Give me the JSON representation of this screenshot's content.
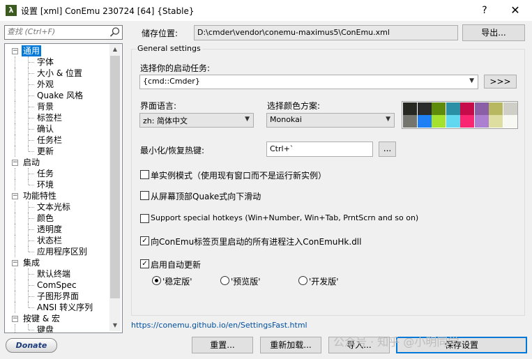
{
  "window": {
    "title": "设置 [xml] ConEmu 230724 [64] {Stable}",
    "app_icon_glyph": "λ",
    "help_glyph": "?",
    "close_glyph": "✕"
  },
  "search": {
    "placeholder": "查找 (Ctrl+F)",
    "value": ""
  },
  "tree": {
    "items": [
      {
        "label": "通用",
        "level": 0,
        "toggle": "−",
        "selected": true
      },
      {
        "label": "字体",
        "level": 1
      },
      {
        "label": "大小 & 位置",
        "level": 1
      },
      {
        "label": "外观",
        "level": 1
      },
      {
        "label": "Quake 风格",
        "level": 1
      },
      {
        "label": "背景",
        "level": 1
      },
      {
        "label": "标签栏",
        "level": 1
      },
      {
        "label": "确认",
        "level": 1
      },
      {
        "label": "任务栏",
        "level": 1
      },
      {
        "label": "更新",
        "level": 1
      },
      {
        "label": "启动",
        "level": 0,
        "toggle": "−"
      },
      {
        "label": "任务",
        "level": 1
      },
      {
        "label": "环境",
        "level": 1
      },
      {
        "label": "功能特性",
        "level": 0,
        "toggle": "−"
      },
      {
        "label": "文本光标",
        "level": 1
      },
      {
        "label": "颜色",
        "level": 1
      },
      {
        "label": "透明度",
        "level": 1
      },
      {
        "label": "状态栏",
        "level": 1
      },
      {
        "label": "应用程序区别",
        "level": 1
      },
      {
        "label": "集成",
        "level": 0,
        "toggle": "−"
      },
      {
        "label": "默认终端",
        "level": 1
      },
      {
        "label": "ComSpec",
        "level": 1
      },
      {
        "label": "子图形界面",
        "level": 1
      },
      {
        "label": "ANSI 转义序列",
        "level": 1
      },
      {
        "label": "按键 & 宏",
        "level": 0,
        "toggle": "−"
      },
      {
        "label": "键盘",
        "level": 1
      }
    ]
  },
  "donate_label": "Donate",
  "storage": {
    "label": "储存位置:",
    "path": "D:\\cmder\\vendor\\conemu-maximus5\\ConEmu.xml",
    "export_label": "导出..."
  },
  "general": {
    "group_title": "General settings",
    "startup_label": "选择你的启动任务:",
    "startup_value": "{cmd::Cmder}",
    "startup_btn": ">>>",
    "lang_label": "界面语言:",
    "lang_value": "zh: 简体中文",
    "scheme_label": "选择颜色方案:",
    "scheme_value": "Monokai",
    "palette": [
      "#272822",
      "#2b2b2b",
      "#5f8b0a",
      "#2b8fa5",
      "#c60b4a",
      "#8b5fa6",
      "#b8b860",
      "#cfcfc8",
      "#757570",
      "#1f7ff5",
      "#a4e22d",
      "#61d8ef",
      "#f92672",
      "#ad7fd0",
      "#dedea0",
      "#f8f8f2"
    ],
    "hotkey_label": "最小化/恢复热键:",
    "hotkey_value": "Ctrl+`",
    "hotkey_btn": "...",
    "checks": [
      {
        "label": "单实例模式（使用现有窗口而不是运行新实例）",
        "checked": false
      },
      {
        "label": "从屏幕顶部Quake式向下滑动",
        "checked": false
      },
      {
        "label": "Support special hotkeys (Win+Number, Win+Tab, PrntScrn and so on)",
        "checked": false
      },
      {
        "label": "向ConEmu标签页里启动的所有进程注入ConEmuHk.dll",
        "checked": true
      },
      {
        "label": "启用自动更新",
        "checked": true
      }
    ],
    "update_channels": [
      {
        "label": "'稳定版'",
        "checked": true
      },
      {
        "label": "'预览版'",
        "checked": false
      },
      {
        "label": "'开发版'",
        "checked": false
      }
    ]
  },
  "footer": {
    "link": "https://conemu.github.io/en/SettingsFast.html",
    "reset": "重置...",
    "reload": "重新加载...",
    "import": "导入...",
    "save": "保存设置"
  },
  "watermark": {
    "text1": "公众号 · 知乎 @小明同学",
    "text2": "@小明同学"
  }
}
